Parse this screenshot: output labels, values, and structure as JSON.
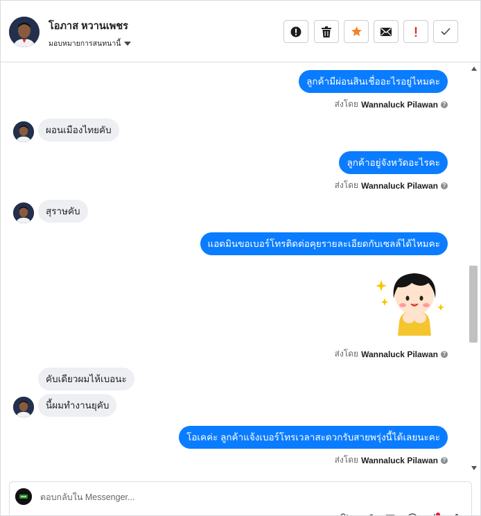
{
  "header": {
    "contact_name": "โอภาส หวานเพชร",
    "assign_label": "มอบหมายการสนทนานี้",
    "actions": [
      "alert-circle-icon",
      "trash-icon",
      "star-icon",
      "envelope-icon",
      "exclamation-icon",
      "checkmark-icon"
    ]
  },
  "conversation": {
    "msg1": "ลูกค้ามีผ่อนสินเชื่ออะไรอยู่ไหมคะ",
    "sent1_prefix": "ส่งโดย",
    "sent1_agent": "Wannaluck Pilawan",
    "msg2": "ผอนเมืองไทยคับ",
    "msg3": "ลูกค้าอยู่จังหวัดอะไรคะ",
    "sent2_prefix": "ส่งโดย",
    "sent2_agent": "Wannaluck Pilawan",
    "msg4": "สุราษคับ",
    "msg5": "แอดมินขอเบอร์โทรติดต่อคุยรายละเอียดกับเซลล์ได้ไหมคะ",
    "sent3_prefix": "ส่งโดย",
    "sent3_agent": "Wannaluck Pilawan",
    "msg6": "คับเดียวผมไห้เบอนะ",
    "msg7": "นี้ผมทำงานยุคับ",
    "msg8": "โอเคค่ะ ลูกค้าแจ้งเบอร์โทรเวลาสะดวกรับสายพรุ่งนี้ได้เลยนะคะ",
    "sent4_prefix": "ส่งโดย",
    "sent4_agent": "Wannaluck Pilawan",
    "help_glyph": "?"
  },
  "composer": {
    "placeholder": "ตอบกลับใน Messenger..."
  },
  "colors": {
    "outgoing_bubble": "#0a7cff",
    "incoming_bubble": "#eeeff2",
    "star": "#f5822b",
    "alert": "#d93025"
  }
}
